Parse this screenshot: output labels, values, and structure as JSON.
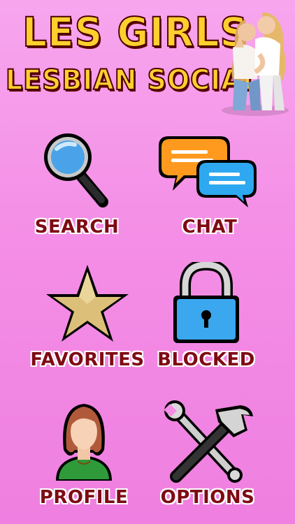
{
  "app": {
    "title_line1": "LES GIRLS",
    "title_line2": "LESBIAN SOCIAL"
  },
  "menu": [
    {
      "label": "SEARCH",
      "icon": "magnifier-icon"
    },
    {
      "label": "CHAT",
      "icon": "chat-bubbles-icon"
    },
    {
      "label": "FAVORITES",
      "icon": "star-icon"
    },
    {
      "label": "BLOCKED",
      "icon": "padlock-icon"
    },
    {
      "label": "PROFILE",
      "icon": "profile-avatar-icon"
    },
    {
      "label": "OPTIONS",
      "icon": "wrench-hammer-icon"
    }
  ],
  "colors": {
    "background": "#f48ee6",
    "title_fill": "#ffcf2e",
    "title_outline": "#4a0000",
    "label_text": "#7e0a14"
  }
}
